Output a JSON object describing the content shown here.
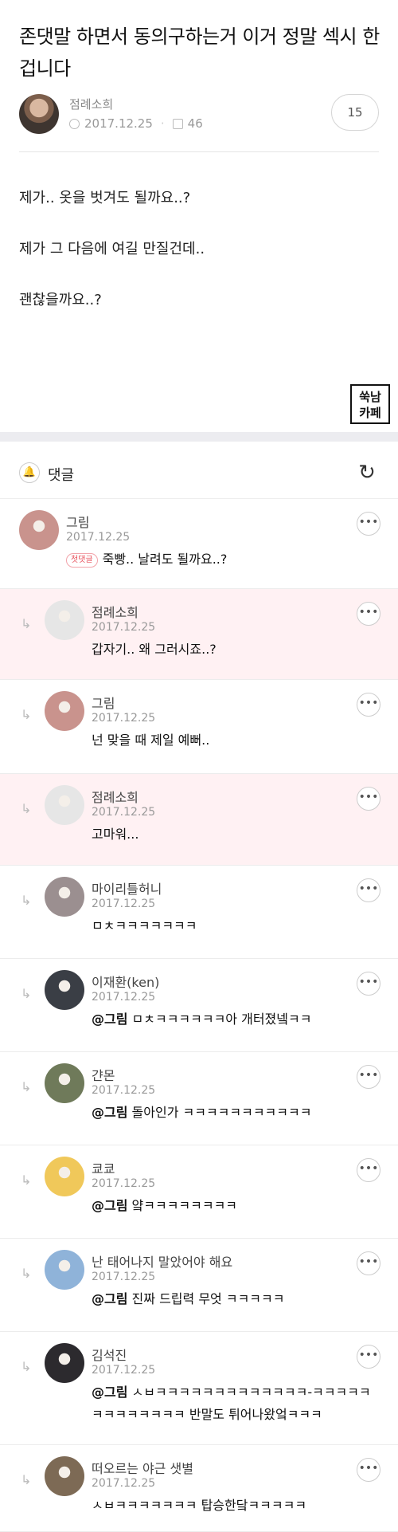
{
  "post": {
    "title": "존댓말 하면서 동의구하는거 이거 정말 섹시 한겁니다",
    "author": "점례소희",
    "date": "2017.12.25",
    "views": "46",
    "comment_count": "15",
    "body": [
      "제가.. 옷을 벗겨도 될까요..?",
      "제가 그 다음에 여길 만질건데..",
      "괜찮을까요..?"
    ],
    "logo_text": "쑥남\n카페"
  },
  "comments_section": {
    "title": "댓글",
    "refresh_icon": "refresh-icon",
    "bell_icon": "bell-icon"
  },
  "comments": [
    {
      "name": "그림",
      "date": "2017.12.25",
      "badge": "첫댓글",
      "mention": "",
      "text": "죽빵.. 날려도 될까요..?",
      "reply": false,
      "highlight": false,
      "avatar_color": "#c9938d"
    },
    {
      "name": "점례소희",
      "date": "2017.12.25",
      "badge": "",
      "mention": "",
      "text": "갑자기.. 왜 그러시죠..?",
      "reply": true,
      "highlight": true,
      "avatar_color": "#e6e6e6"
    },
    {
      "name": "그림",
      "date": "2017.12.25",
      "badge": "",
      "mention": "",
      "text": "넌 맞을 때 제일 예뻐..",
      "reply": true,
      "highlight": false,
      "avatar_color": "#c9938d"
    },
    {
      "name": "점례소희",
      "date": "2017.12.25",
      "badge": "",
      "mention": "",
      "text": "고마워...",
      "reply": true,
      "highlight": true,
      "avatar_color": "#e6e6e6"
    },
    {
      "name": "마이리틀허니",
      "date": "2017.12.25",
      "badge": "",
      "mention": "",
      "text": "ㅁㅊㅋㅋㅋㅋㅋㅋㅋ",
      "reply": true,
      "highlight": false,
      "avatar_color": "#9b8f90"
    },
    {
      "name": "이재환(ken)",
      "date": "2017.12.25",
      "badge": "",
      "mention": "@그림",
      "text": "ㅁㅊㅋㅋㅋㅋㅋㅋ아 개터졌넼ㅋㅋ",
      "reply": true,
      "highlight": false,
      "avatar_color": "#3a3e45"
    },
    {
      "name": "갼몬",
      "date": "2017.12.25",
      "badge": "",
      "mention": "@그림",
      "text": "돌아인가 ㅋㅋㅋㅋㅋㅋㅋㅋㅋㅋㅋ",
      "reply": true,
      "highlight": false,
      "avatar_color": "#6f7a5a"
    },
    {
      "name": "쿄쿄",
      "date": "2017.12.25",
      "badge": "",
      "mention": "@그림",
      "text": "얔ㅋㅋㅋㅋㅋㅋㅋㅋ",
      "reply": true,
      "highlight": false,
      "avatar_color": "#f0c85a"
    },
    {
      "name": "난 태어나지 말았어야 해요",
      "date": "2017.12.25",
      "badge": "",
      "mention": "@그림",
      "text": "진짜 드립력 무엇 ㅋㅋㅋㅋㅋ",
      "reply": true,
      "highlight": false,
      "avatar_color": "#8fb3d9"
    },
    {
      "name": "김석진",
      "date": "2017.12.25",
      "badge": "",
      "mention": "@그림",
      "text": "ㅅㅂㅋㅋㅋㅋㅋㅋㅋㅋㅋㅋㅋㅋㅋ-ㅋㅋㅋㅋㅋ\nㅋㅋㅋㅋㅋㅋㅋㅋ 반말도 튀어나왔엌ㅋㅋㅋ",
      "reply": true,
      "highlight": false,
      "avatar_color": "#2c2a2e"
    },
    {
      "name": "떠오르는 야근 샛별",
      "date": "2017.12.25",
      "badge": "",
      "mention": "",
      "text": "ㅅㅂㅋㅋㅋㅋㅋㅋㅋ 탑승한닼ㅋㅋㅋㅋㅋ",
      "reply": true,
      "highlight": false,
      "avatar_color": "#7d6a55"
    }
  ]
}
